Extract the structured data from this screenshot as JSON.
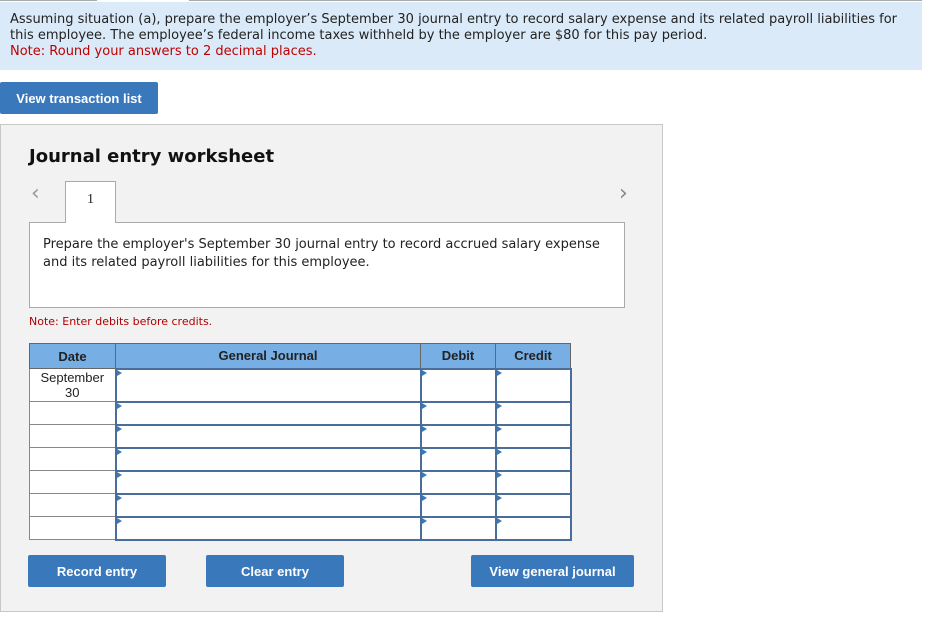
{
  "question": {
    "text": "Assuming situation (a), prepare the employer’s September 30 journal entry to record salary expense and its related payroll liabilities for this employee. The employee’s federal income taxes withheld by the employer are $80 for this pay period.",
    "note": "Note: Round your answers to 2 decimal places."
  },
  "buttons": {
    "view_transaction_list": "View transaction list",
    "record_entry": "Record entry",
    "clear_entry": "Clear entry",
    "view_general_journal": "View general journal"
  },
  "worksheet": {
    "title": "Journal entry worksheet",
    "prev_icon": "‹",
    "next_icon": "›",
    "active_tab": "1",
    "prompt": "Prepare the employer's September 30 journal entry to record accrued salary expense and its related payroll liabilities for this employee.",
    "hint": "Note: Enter debits before credits."
  },
  "journal": {
    "headers": [
      "Date",
      "General Journal",
      "Debit",
      "Credit"
    ],
    "rows": [
      {
        "date": "September\n30",
        "account": "",
        "debit": "",
        "credit": ""
      },
      {
        "date": "",
        "account": "",
        "debit": "",
        "credit": ""
      },
      {
        "date": "",
        "account": "",
        "debit": "",
        "credit": ""
      },
      {
        "date": "",
        "account": "",
        "debit": "",
        "credit": ""
      },
      {
        "date": "",
        "account": "",
        "debit": "",
        "credit": ""
      },
      {
        "date": "",
        "account": "",
        "debit": "",
        "credit": ""
      },
      {
        "date": "",
        "account": "",
        "debit": "",
        "credit": ""
      }
    ]
  }
}
